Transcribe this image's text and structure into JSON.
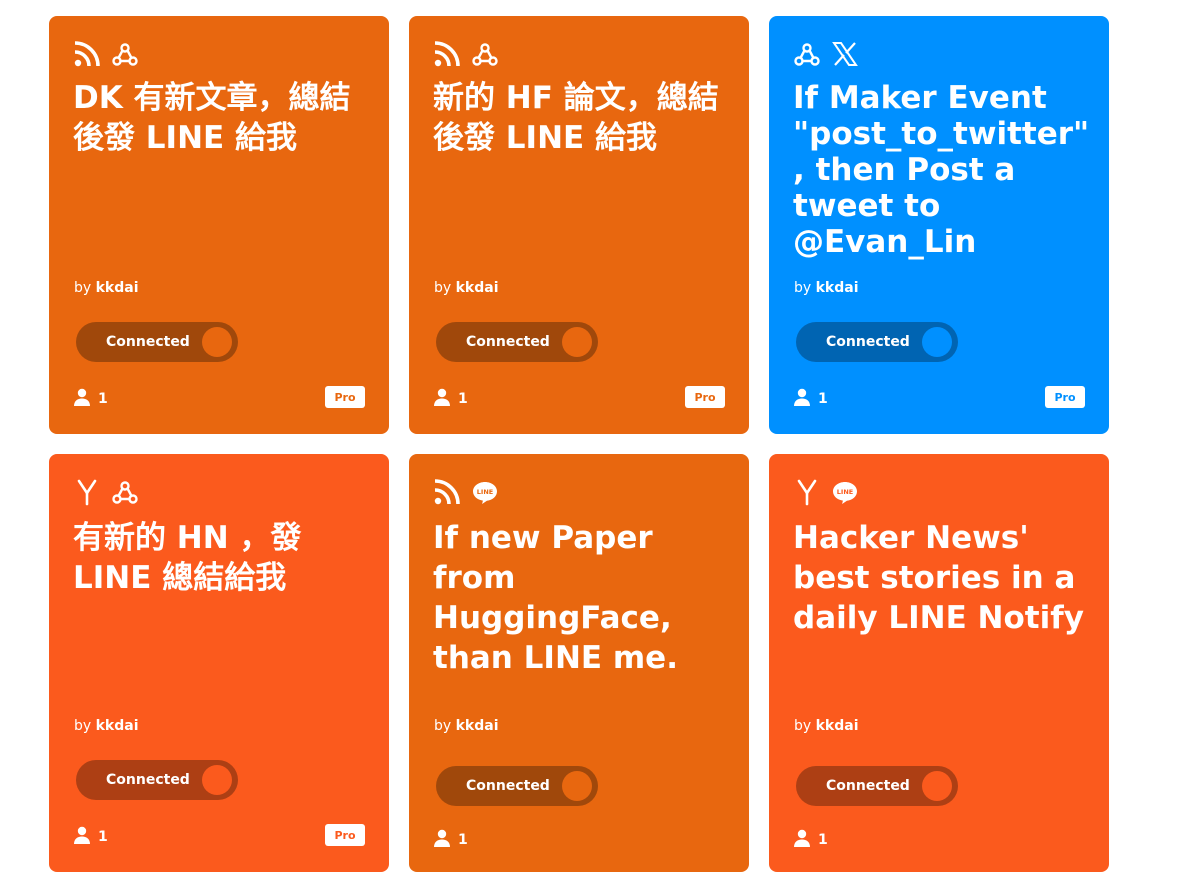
{
  "colors": {
    "orange": "#e8670f",
    "red_orange": "#fb5a1d",
    "blue": "#0090ff",
    "dark_orange_track": "#a0480b",
    "dark_red_track": "#ad3f14",
    "dark_blue_track": "#0064b2"
  },
  "cards": [
    {
      "icons": [
        "rss-icon",
        "webhooks-icon"
      ],
      "title": "DK 有新文章，總結後發 LINE 給我",
      "by_prefix": "by",
      "author": "kkdai",
      "toggle_label": "Connected",
      "users": "1",
      "badge": "Pro"
    },
    {
      "icons": [
        "rss-icon",
        "webhooks-icon"
      ],
      "title": "新的 HF 論文，總結後發 LINE 給我",
      "by_prefix": "by",
      "author": "kkdai",
      "toggle_label": "Connected",
      "users": "1",
      "badge": "Pro"
    },
    {
      "icons": [
        "webhooks-icon",
        "x-icon"
      ],
      "title": "If Maker Event \"post_to_twitter\", then Post a tweet to @Evan_Lin",
      "by_prefix": "by",
      "author": "kkdai",
      "toggle_label": "Connected",
      "users": "1",
      "badge": "Pro"
    },
    {
      "icons": [
        "hacker-news-icon",
        "webhooks-icon"
      ],
      "title": "有新的 HN ，發 LINE 總結給我",
      "by_prefix": "by",
      "author": "kkdai",
      "toggle_label": "Connected",
      "users": "1",
      "badge": "Pro"
    },
    {
      "icons": [
        "rss-icon",
        "line-icon"
      ],
      "title": "If new Paper from HuggingFace, than LINE me.",
      "by_prefix": "by",
      "author": "kkdai",
      "toggle_label": "Connected",
      "users": "1",
      "badge": ""
    },
    {
      "icons": [
        "hacker-news-icon",
        "line-icon"
      ],
      "title": "Hacker News' best stories in a daily LINE Notify",
      "by_prefix": "by",
      "author": "kkdai",
      "toggle_label": "Connected",
      "users": "1",
      "badge": ""
    }
  ]
}
